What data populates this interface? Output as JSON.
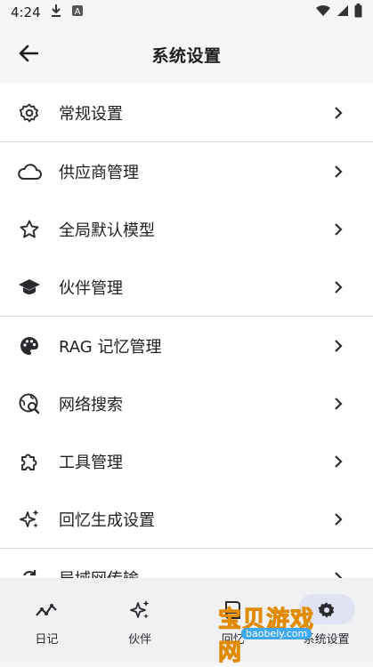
{
  "status_bar": {
    "time": "4:24",
    "icons": [
      "download-icon",
      "a-box-icon",
      "wifi-icon",
      "signal-icon",
      "battery-icon"
    ]
  },
  "header": {
    "title": "系统设置",
    "back_icon": "arrow-left-icon"
  },
  "settings": [
    {
      "icon": "gear-icon",
      "label": "常规设置"
    },
    {
      "icon": "cloud-icon",
      "label": "供应商管理"
    },
    {
      "icon": "star-icon",
      "label": "全局默认模型"
    },
    {
      "icon": "mortarboard-icon",
      "label": "伙伴管理"
    },
    {
      "icon": "palette-icon",
      "label": "RAG 记忆管理"
    },
    {
      "icon": "globe-search-icon",
      "label": "网络搜索"
    },
    {
      "icon": "puzzle-icon",
      "label": "工具管理"
    },
    {
      "icon": "sparkle-icon",
      "label": "回忆生成设置"
    },
    {
      "icon": "sync-icon",
      "label": "局域网传输"
    }
  ],
  "bottom_nav": [
    {
      "icon": "trend-icon",
      "label": "日记"
    },
    {
      "icon": "sparkle-icon",
      "label": "伙伴"
    },
    {
      "icon": "book-icon",
      "label": "回忆"
    },
    {
      "icon": "settings-icon",
      "label": "系统设置",
      "active": true
    }
  ],
  "watermark": {
    "text": "宝贝游戏网",
    "url": "baobeiy.com"
  },
  "colors": {
    "background": "#f6f6f8",
    "list_bg": "#ffffff",
    "nav_bg": "#f1f1f4",
    "active_pill": "#dfe3f3"
  }
}
